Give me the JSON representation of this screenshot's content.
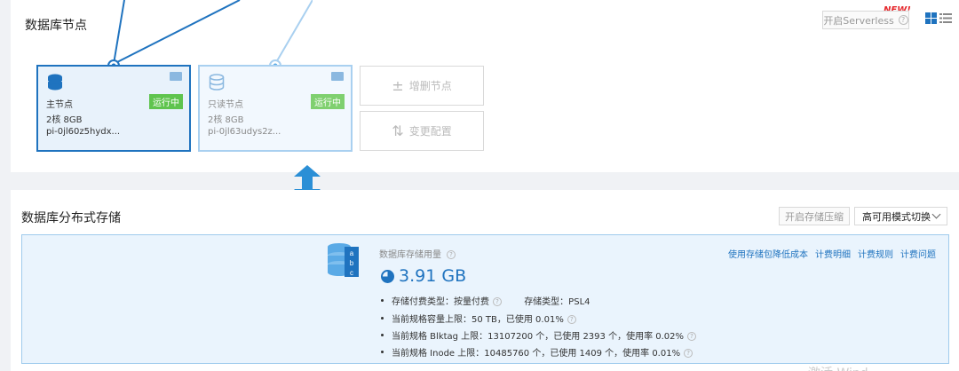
{
  "nodes_section": {
    "title": "数据库节点",
    "serverless_button": "开启Serverless",
    "new_badge": "NEW!",
    "primary": {
      "name": "主节点",
      "spec": "2核 8GB",
      "id": "pi-0jl60z5hydx...",
      "status": "运行中"
    },
    "readonly": {
      "name": "只读节点",
      "spec": "2核 8GB",
      "id": "pi-0jl63udys2z...",
      "status": "运行中"
    },
    "add_remove_button": "增删节点",
    "change_config_button": "变更配置"
  },
  "storage_section": {
    "title": "数据库分布式存储",
    "compress_button": "开启存储压缩",
    "ha_dropdown": "高可用模式切换",
    "usage_label": "数据库存储用量",
    "usage_value": "3.91 GB",
    "billing_type": "存储付费类型：按量付费",
    "storage_type": "存储类型：PSL4",
    "capacity": "当前规格容量上限：50 TB，已使用 0.01%",
    "blktag": "当前规格 Blktag 上限：13107200 个，已使用 2393 个，使用率 0.02%",
    "inode": "当前规格 Inode 上限：10485760 个，已使用 1409 个，使用率 0.01%",
    "links": [
      "使用存储包降低成本",
      "计费明细",
      "计费规则",
      "计费问题"
    ],
    "icon_letters": [
      "a",
      "b",
      "c"
    ]
  },
  "watermark": "激活 Wind"
}
